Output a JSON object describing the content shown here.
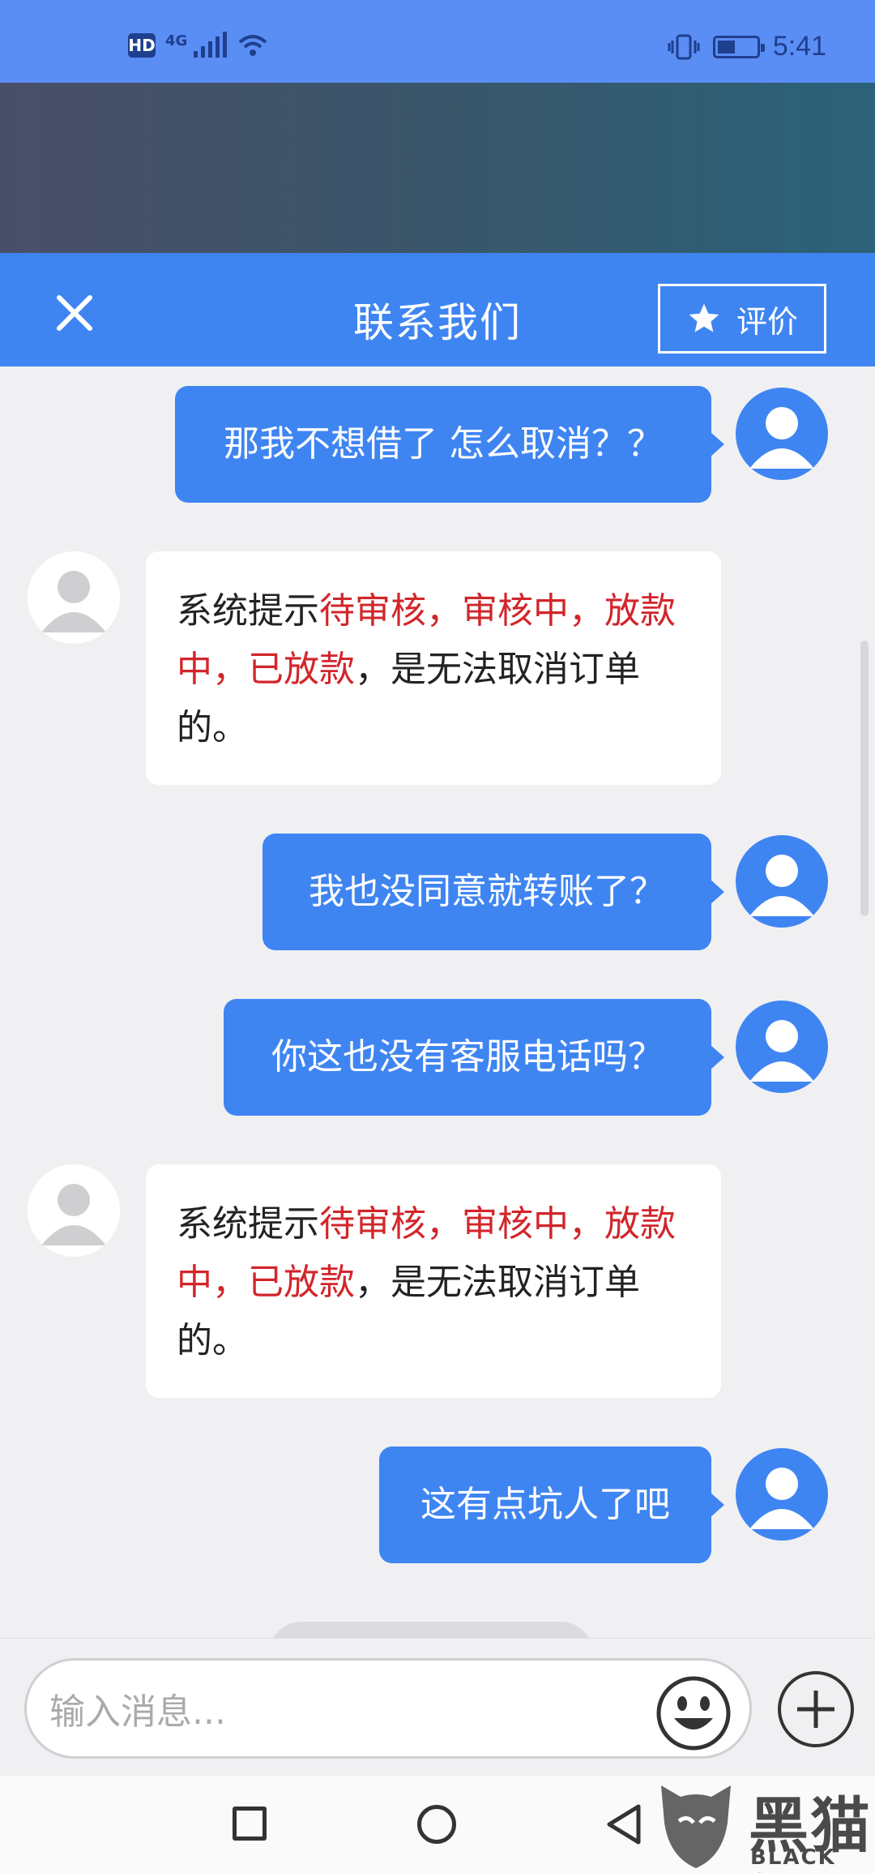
{
  "status_bar": {
    "hd": "HD",
    "network": "4G",
    "time": "5:41"
  },
  "header": {
    "title": "联系我们",
    "rate_label": "评价"
  },
  "messages": [
    {
      "from": "user",
      "text": "那我不想借了 怎么取消？？"
    },
    {
      "from": "agent",
      "parts": [
        "系统提示",
        "待审核，审核中，放款中，已放款",
        "，是无法取消订单的。"
      ]
    },
    {
      "from": "user",
      "text": "我也没同意就转账了？"
    },
    {
      "from": "user",
      "text": "你这也没有客服电话吗？"
    },
    {
      "from": "agent",
      "parts": [
        "系统提示",
        "待审核，审核中，放款中，已放款",
        "，是无法取消订单的。"
      ]
    },
    {
      "from": "user",
      "text": "这有点坑人了吧"
    }
  ],
  "input": {
    "placeholder": "输入消息..."
  },
  "watermark": {
    "cn": "黑猫",
    "en": "BLACK CAT"
  },
  "colors": {
    "status_bar": "#5b8ef5",
    "header": "#3f85f2",
    "user_bubble": "#3f85f2",
    "highlight_red": "#d2262b"
  },
  "icons": [
    "close-icon",
    "star-icon",
    "user-avatar-icon",
    "agent-avatar-icon",
    "emoji-icon",
    "plus-icon",
    "nav-recent-icon",
    "nav-home-icon",
    "nav-back-icon",
    "black-cat-logo"
  ]
}
